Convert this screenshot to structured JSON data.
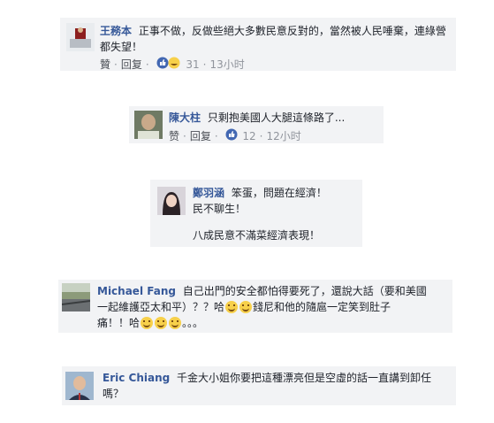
{
  "comments": [
    {
      "author": "王務本",
      "text": "正事不做，反做些絕大多數民意反對的，當然被人民唾棄，連綠營都失望！",
      "like_label": "贊",
      "reply_label": "回复",
      "reaction_count": "31",
      "time": "13小时"
    },
    {
      "author": "陳大柱",
      "text": "只剩抱美國人大腿這條路了...",
      "like_label": "赞",
      "reply_label": "回复",
      "reaction_count": "12",
      "time": "12小时"
    },
    {
      "author": "鄭羽涵",
      "line1": "笨蛋，問題在經濟！",
      "line2": "民不聊生！",
      "line3": "八成民意不滿菜經濟表現！"
    },
    {
      "author": "Michael Fang",
      "line1": "自己出門的安全都怕得要死了，還說大話（要和美國",
      "line2a": "一起維護亞太和平）？？哈",
      "line2b": "錢尼和他的隨扈一定笑到肚子",
      "line3a": "痛！！哈",
      "line3b": "。。。"
    },
    {
      "author": "Eric Chiang",
      "line1": "千金大小姐你要把這種漂亮但是空虛的話一直講到卸任",
      "line2": "嗎？"
    }
  ],
  "icons": [
    "like-reaction-icon",
    "love-reaction-icon",
    "laughing-emoji-icon"
  ],
  "colors": {
    "author": "#365899",
    "bubble": "#f2f3f5",
    "like_blue": "#4267b2",
    "love_red": "#f25268"
  }
}
